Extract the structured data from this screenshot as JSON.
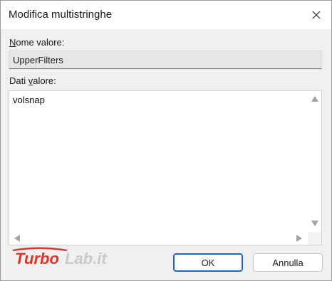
{
  "window": {
    "title": "Modifica multistringhe"
  },
  "name_label": {
    "prefix": "",
    "accel": "N",
    "rest": "ome valore:"
  },
  "name_value": "UpperFilters",
  "data_label": {
    "prefix": "Dati ",
    "accel": "v",
    "rest": "alore:"
  },
  "data_value": "volsnap",
  "buttons": {
    "ok": "OK",
    "cancel": "Annulla"
  },
  "watermark": {
    "text": "TurboLab.it",
    "part1": "Turbo",
    "part2": "Lab.it"
  },
  "icons": {
    "close": "close-icon",
    "scroll_up": "arrow-up-icon",
    "scroll_down": "arrow-down-icon",
    "scroll_left": "arrow-left-icon",
    "scroll_right": "arrow-right-icon"
  },
  "colors": {
    "accent": "#1f66c7",
    "watermark_red": "#e0312b",
    "watermark_grey": "#c9c9c9"
  }
}
